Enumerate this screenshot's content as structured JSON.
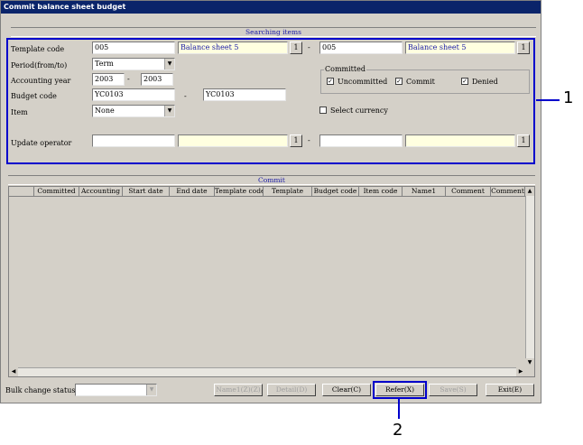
{
  "window": {
    "title": "Commit balance sheet budget"
  },
  "search": {
    "header": "Searching items",
    "template_code_label": "Template code",
    "template_code_from": "005",
    "template_name_from": "Balance sheet 5",
    "template_code_to": "005",
    "template_name_to": "Balance sheet 5",
    "lookup_btn": "1",
    "range_sep": "-",
    "period_label": "Period(from/to)",
    "period_value": "Term",
    "acct_year_label": "Accounting year",
    "acct_year_from": "2003",
    "acct_year_to": "2003",
    "budget_code_label": "Budget code",
    "budget_code_from": "YC0103",
    "budget_code_to": "YC0103",
    "item_label": "Item",
    "item_value": "None",
    "update_operator_label": "Update operator",
    "committed_group": "Committed",
    "uncommitted": "Uncommitted",
    "commit": "Commit",
    "denied": "Denied",
    "check_mark": "✓",
    "select_currency": "Select currency"
  },
  "grid": {
    "header": "Commit",
    "columns": [
      "Committed",
      "Accounting",
      "Start date",
      "End date",
      "Template code",
      "Template",
      "Budget code",
      "Item code",
      "Name1",
      "Comment",
      "Comment"
    ]
  },
  "footer": {
    "bulk_label": "Bulk change status",
    "name1": "Name1(Z)(Z)",
    "detail": "Detail(D)",
    "clear": "Clear(C)",
    "refer": "Refer(X)",
    "save": "Save(S)",
    "exit": "Exit(E)"
  },
  "callouts": {
    "one": "1",
    "two": "2"
  }
}
